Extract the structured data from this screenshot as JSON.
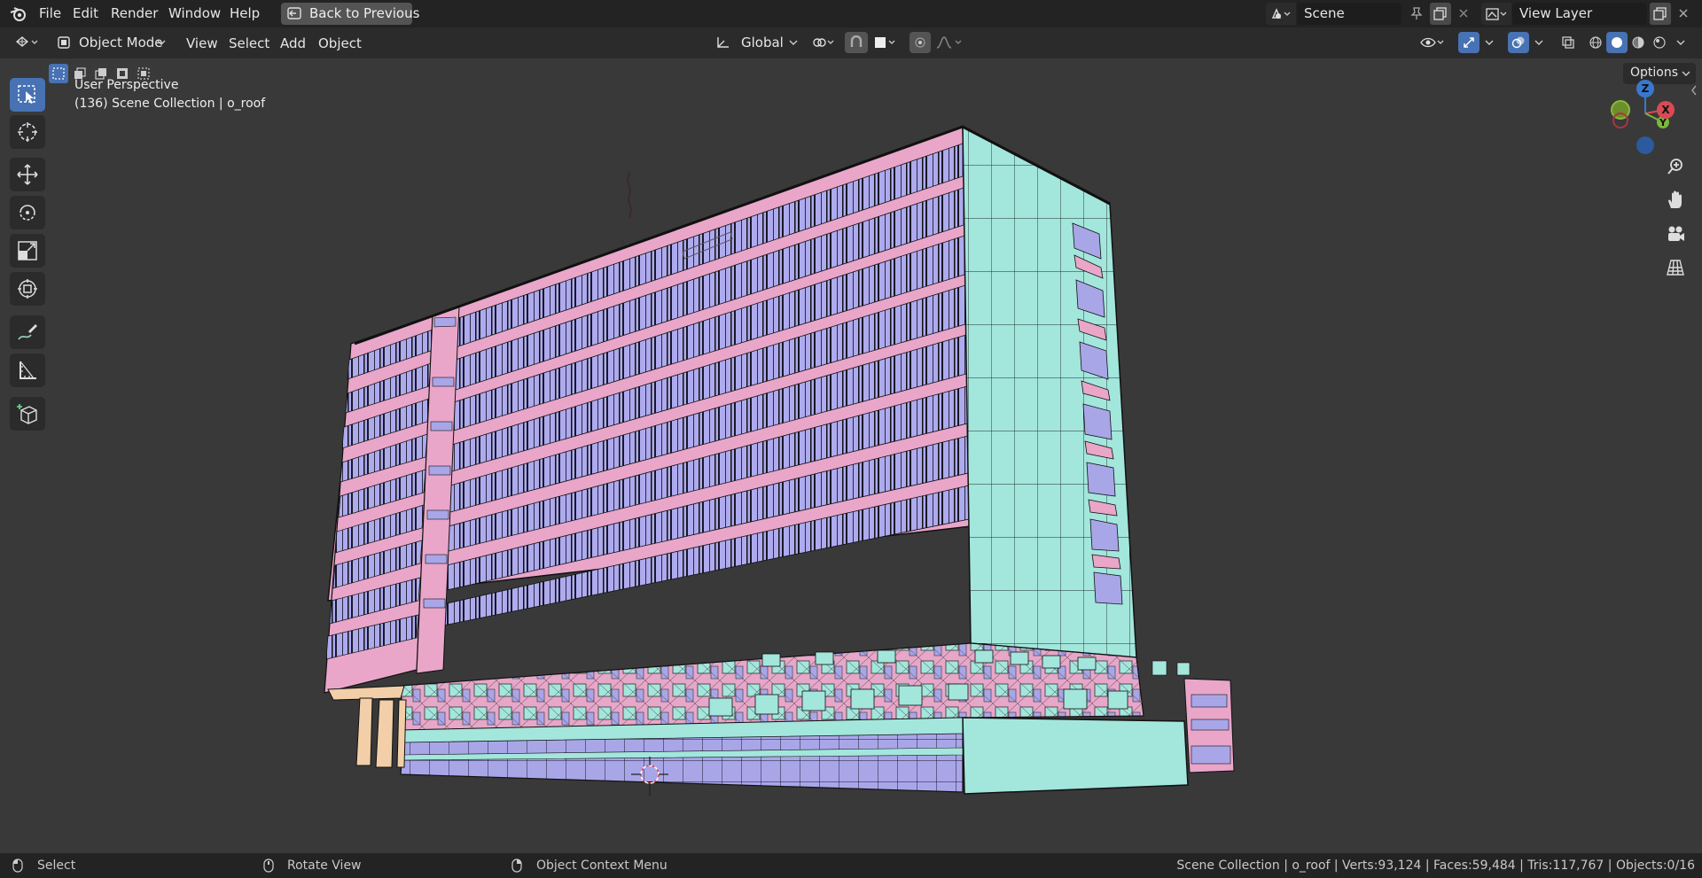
{
  "app": {
    "logo_icon": "blender-logo-icon"
  },
  "top_menu": {
    "file": "File",
    "edit": "Edit",
    "render": "Render",
    "window": "Window",
    "help": "Help",
    "back_button": "Back to Previous"
  },
  "scene": {
    "label": "Scene",
    "view_layer": "View Layer"
  },
  "header": {
    "mode": "Object Mode",
    "view": "View",
    "select": "Select",
    "add": "Add",
    "object": "Object",
    "transform_orientation": "Global",
    "options": "Options"
  },
  "viewport": {
    "perspective": "User Perspective",
    "collection": "(136) Scene Collection | o_roof"
  },
  "gizmo": {
    "z": "Z",
    "x": "X",
    "y": "Y"
  },
  "status": {
    "select": "Select",
    "rotate": "Rotate View",
    "context_menu": "Object Context Menu",
    "stats": "Scene Collection | o_roof | Verts:93,124 | Faces:59,484 | Tris:117,767 | Objects:0/16"
  },
  "colors": {
    "accent": "#4772b3",
    "pink": "#e9a6c9",
    "cyan": "#a3e6dc",
    "window": "#a9a6e8"
  }
}
